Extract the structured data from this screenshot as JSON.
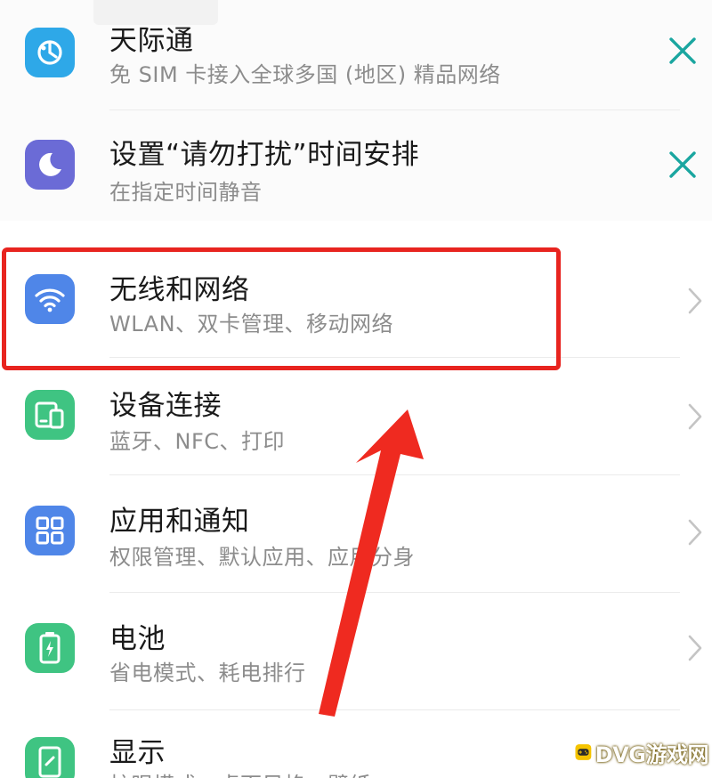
{
  "suggestions": [
    {
      "title": "天际通",
      "subtitle": "免 SIM 卡接入全球多国 (地区) 精品网络",
      "icon": "globe-icon",
      "icon_color": "#2ea8e8",
      "action": "dismiss"
    },
    {
      "title": "设置“请勿打扰”时间安排",
      "subtitle": "在指定时间静音",
      "icon": "moon-icon",
      "icon_color": "#6b6bd6",
      "action": "dismiss"
    }
  ],
  "settings": [
    {
      "title": "无线和网络",
      "subtitle": "WLAN、双卡管理、移动网络",
      "icon": "wifi-icon",
      "icon_color": "#4f86e8"
    },
    {
      "title": "设备连接",
      "subtitle": "蓝牙、NFC、打印",
      "icon": "device-connect-icon",
      "icon_color": "#3fc482"
    },
    {
      "title": "应用和通知",
      "subtitle": "权限管理、默认应用、应用分身",
      "icon": "apps-grid-icon",
      "icon_color": "#4f86e8"
    },
    {
      "title": "电池",
      "subtitle": "省电模式、耗电排行",
      "icon": "battery-icon",
      "icon_color": "#3fc482"
    },
    {
      "title": "显示",
      "subtitle": "护眼模式、桌面风格、壁纸",
      "icon": "display-icon",
      "icon_color": "#3fc482"
    }
  ],
  "colors": {
    "dismiss_accent": "#1aa6a0",
    "highlight": "#e8241f"
  },
  "watermark": {
    "text": "DVG游戏网",
    "icon": "gamepad-icon"
  }
}
